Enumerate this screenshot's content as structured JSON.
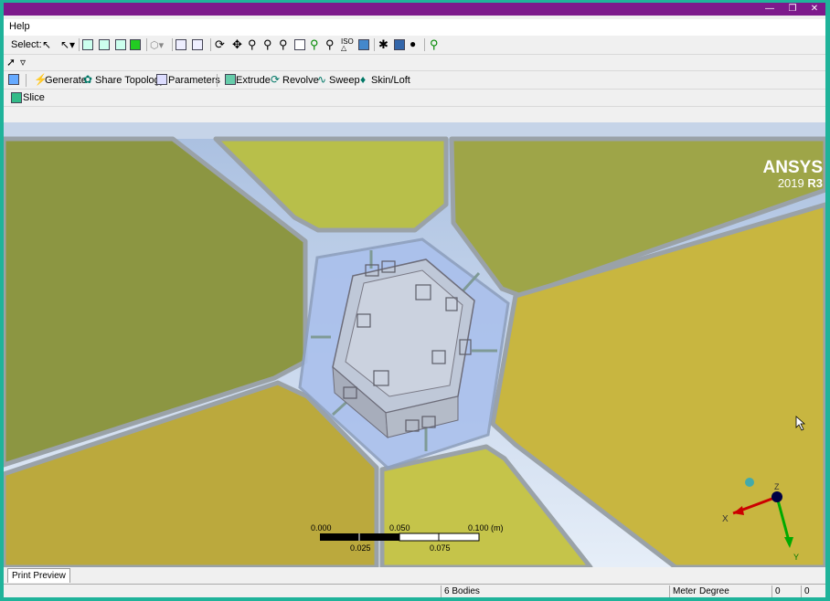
{
  "menu": {
    "help": "Help"
  },
  "toolbar1": {
    "select_label": "Select:"
  },
  "toolbar3": {
    "generate": "Generate",
    "share_topology": "Share Topology",
    "parameters": "Parameters",
    "extrude": "Extrude",
    "revolve": "Revolve",
    "sweep": "Sweep",
    "skin_loft": "Skin/Loft"
  },
  "toolbar4": {
    "slice": "Slice"
  },
  "viewport": {
    "brand": "ANSYS",
    "version_prefix": "2019 ",
    "version_bold": "R3",
    "scale": {
      "top_labels": [
        "0.000",
        "0.050",
        "0.100 (m)"
      ],
      "bottom_labels": [
        "0.025",
        "0.075"
      ]
    },
    "axes": {
      "x": "X",
      "y": "Y",
      "z": "Z"
    }
  },
  "tabs": {
    "print_preview": "Print Preview"
  },
  "status": {
    "bodies": "6 Bodies",
    "units": "Meter",
    "angle": "Degree",
    "val1": "0",
    "val2": "0"
  },
  "colors": {
    "title_bar": "#7d1a8c",
    "frame": "#1fb39a",
    "panel_green": "#9aa84a",
    "panel_yellow": "#c8b840"
  }
}
